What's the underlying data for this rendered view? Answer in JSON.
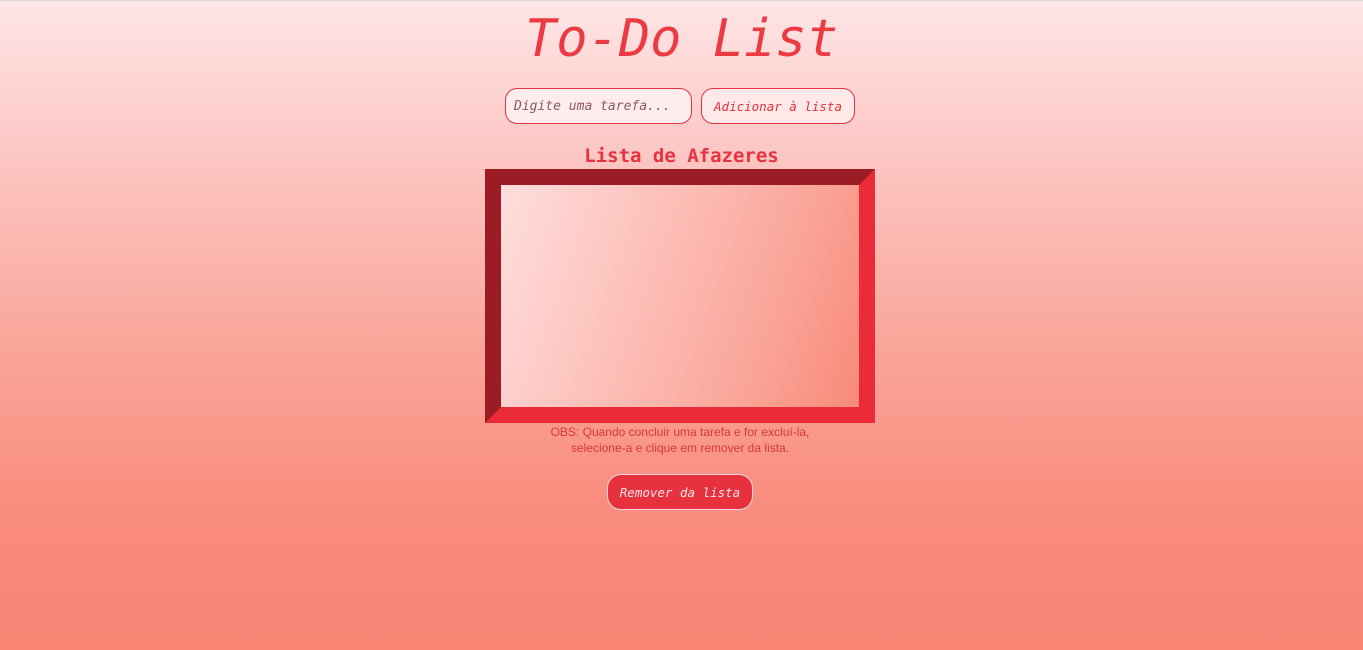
{
  "header": {
    "title": "To-Do List"
  },
  "form": {
    "task_placeholder": "Digite uma tarefa...",
    "task_value": "",
    "add_button_label": "Adicionar à lista"
  },
  "list": {
    "heading": "Lista de Afazeres",
    "items": []
  },
  "note": {
    "line1": "OBS: Quando concluir uma tarefa e for excluí-la,",
    "line2": "selecione-a e clique em remover da lista."
  },
  "actions": {
    "remove_button_label": "Remover da lista"
  },
  "colors": {
    "accent": "#e8313f",
    "accent_dark": "#9b1c24",
    "background_top": "#ffe6e6",
    "background_bottom": "#f98474"
  }
}
